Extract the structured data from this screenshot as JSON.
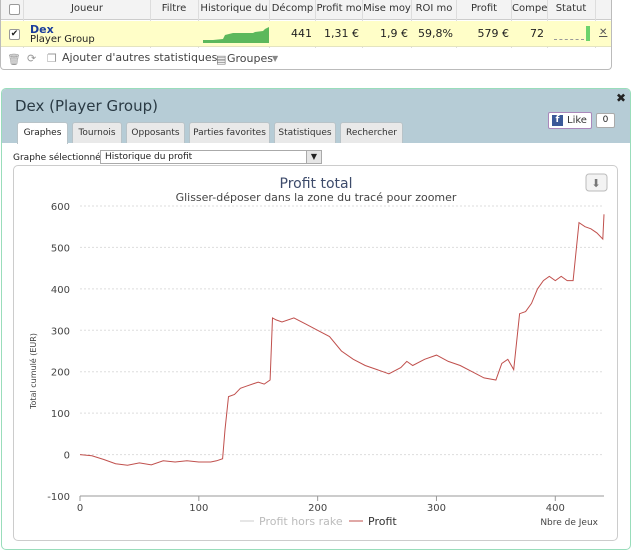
{
  "table": {
    "headers": [
      "Joueur",
      "Filtre",
      "Historique du",
      "Décomp",
      "Profit mo",
      "Mise moy",
      "ROI mo",
      "Profit",
      "Compe",
      "Statut"
    ],
    "row": {
      "name": "Dex",
      "site": "Player Group",
      "hands": "441",
      "profit_per_100": "1,31 €",
      "avg_stake": "1,9 €",
      "roi": "59,8%",
      "profit": "579 €",
      "compe": "72"
    },
    "footer": {
      "add_stats": "Ajouter d'autres statistiques",
      "groups": "Groupes"
    }
  },
  "panel": {
    "title": "Dex (Player Group)",
    "tabs": [
      "Graphes",
      "Tournois",
      "Opposants",
      "Parties favorites",
      "Statistiques",
      "Rechercher"
    ],
    "active_tab": 0,
    "graph_label": "Graphe sélectionné :",
    "graph_select_value": "Historique du profit",
    "like_label": "Like",
    "like_count": "0"
  },
  "colors": {
    "profit_line": "#c0504d",
    "rake_line": "#cccccc",
    "header_bg": "#b6ccd6",
    "row_bg": "#fffec8"
  },
  "chart_data": {
    "type": "line",
    "title": "Profit total",
    "subtitle": "Glisser-déposer dans la zone du tracé pour zoomer",
    "ylabel": "Total cumulé (EUR)",
    "xlabel": "Nbre de Jeux",
    "xlim": [
      0,
      441
    ],
    "ylim": [
      -100,
      600
    ],
    "x_ticks": [
      "0",
      "100",
      "200",
      "300",
      "400"
    ],
    "y_ticks": [
      "-100",
      "0",
      "100",
      "200",
      "300",
      "400",
      "500",
      "600"
    ],
    "legend": [
      "Profit hors rake",
      "Profit"
    ],
    "series": [
      {
        "name": "Profit hors rake",
        "x": [],
        "values": []
      },
      {
        "name": "Profit",
        "x": [
          0,
          10,
          20,
          30,
          40,
          50,
          60,
          70,
          80,
          90,
          100,
          110,
          115,
          120,
          122,
          125,
          130,
          135,
          140,
          150,
          155,
          160,
          162,
          165,
          170,
          180,
          190,
          200,
          210,
          220,
          230,
          240,
          250,
          260,
          270,
          275,
          280,
          290,
          300,
          310,
          320,
          330,
          340,
          350,
          355,
          360,
          365,
          370,
          375,
          380,
          385,
          390,
          395,
          400,
          405,
          410,
          415,
          420,
          425,
          430,
          435,
          440,
          441
        ],
        "values": [
          0,
          -3,
          -12,
          -22,
          -26,
          -20,
          -25,
          -15,
          -18,
          -15,
          -18,
          -18,
          -15,
          -10,
          60,
          140,
          145,
          160,
          165,
          175,
          170,
          180,
          330,
          325,
          320,
          330,
          315,
          300,
          285,
          250,
          230,
          215,
          205,
          195,
          210,
          225,
          215,
          230,
          240,
          225,
          215,
          200,
          185,
          180,
          220,
          230,
          205,
          340,
          345,
          365,
          400,
          420,
          430,
          420,
          430,
          420,
          420,
          560,
          550,
          545,
          535,
          520,
          580
        ]
      }
    ]
  }
}
